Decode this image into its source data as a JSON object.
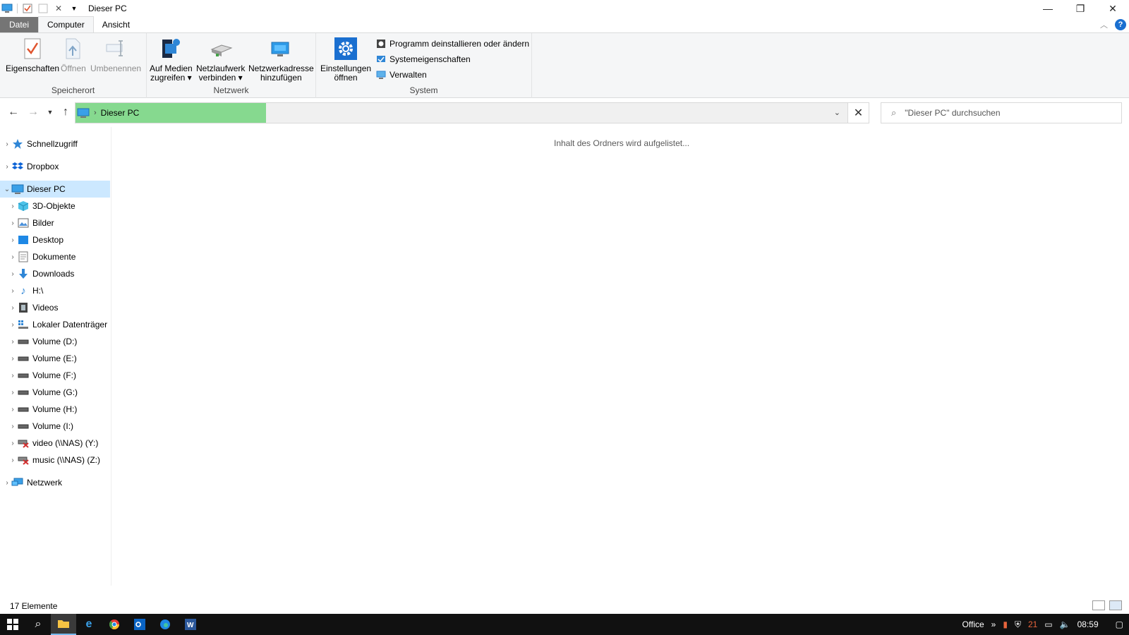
{
  "window": {
    "title": "Dieser PC",
    "controls": {
      "minimize": "—",
      "restore": "❐",
      "close": "✕"
    }
  },
  "ribbon_tabs": [
    {
      "label": "Datei"
    },
    {
      "label": "Computer"
    },
    {
      "label": "Ansicht"
    }
  ],
  "ribbon": {
    "groups": {
      "location": {
        "label": "Speicherort",
        "buttons": [
          "Eigenschaften",
          "Öffnen",
          "Umbenennen"
        ]
      },
      "network": {
        "label": "Netzwerk",
        "buttons": [
          {
            "line1": "Auf Medien",
            "line2": "zugreifen ▾"
          },
          {
            "line1": "Netzlaufwerk",
            "line2": "verbinden ▾"
          },
          {
            "line1": "Netzwerkadresse",
            "line2": "hinzufügen"
          }
        ]
      },
      "system": {
        "label": "System",
        "big_button": {
          "line1": "Einstellungen",
          "line2": "öffnen"
        },
        "small_buttons": [
          "Programm deinstallieren oder ändern",
          "Systemeigenschaften",
          "Verwalten"
        ]
      }
    }
  },
  "address": {
    "crumb": "Dieser PC",
    "search_placeholder": "\"Dieser PC\" durchsuchen"
  },
  "nav_tree": [
    {
      "label": "Schnellzugriff",
      "icon": "star-icon",
      "level": 0
    },
    {
      "label": "Dropbox",
      "icon": "dropbox-icon",
      "level": 0
    },
    {
      "label": "Dieser PC",
      "icon": "computer-icon",
      "level": 0,
      "selected": true,
      "expanded": true
    },
    {
      "label": "3D-Objekte",
      "icon": "cube-icon",
      "level": 1
    },
    {
      "label": "Bilder",
      "icon": "pictures-icon",
      "level": 1
    },
    {
      "label": "Desktop",
      "icon": "desktop-icon",
      "level": 1
    },
    {
      "label": "Dokumente",
      "icon": "documents-icon",
      "level": 1
    },
    {
      "label": "Downloads",
      "icon": "download-icon",
      "level": 1
    },
    {
      "label": "H:\\",
      "icon": "music-note-icon",
      "level": 1
    },
    {
      "label": "Videos",
      "icon": "video-icon",
      "level": 1
    },
    {
      "label": "Lokaler Datenträger",
      "icon": "windows-drive-icon",
      "level": 1
    },
    {
      "label": "Volume (D:)",
      "icon": "drive-icon",
      "level": 1
    },
    {
      "label": "Volume (E:)",
      "icon": "drive-icon",
      "level": 1
    },
    {
      "label": "Volume (F:)",
      "icon": "drive-icon",
      "level": 1
    },
    {
      "label": "Volume (G:)",
      "icon": "drive-icon",
      "level": 1
    },
    {
      "label": "Volume (H:)",
      "icon": "drive-icon",
      "level": 1
    },
    {
      "label": "Volume (I:)",
      "icon": "drive-icon",
      "level": 1
    },
    {
      "label": "video (\\\\NAS) (Y:)",
      "icon": "disconnected-drive-icon",
      "level": 1
    },
    {
      "label": "music (\\\\NAS) (Z:)",
      "icon": "disconnected-drive-icon",
      "level": 1
    },
    {
      "label": "Netzwerk",
      "icon": "network-icon",
      "level": 0
    }
  ],
  "content": {
    "message": "Inhalt des Ordners wird aufgelistet..."
  },
  "status": {
    "count": "17 Elemente"
  },
  "taskbar": {
    "tray_label": "Office",
    "badge": "21",
    "time": "08:59"
  },
  "colors": {
    "selection": "#cce8ff",
    "address_highlight": "#86d98f",
    "file_tab": "#757575",
    "taskbar": "#111111"
  }
}
